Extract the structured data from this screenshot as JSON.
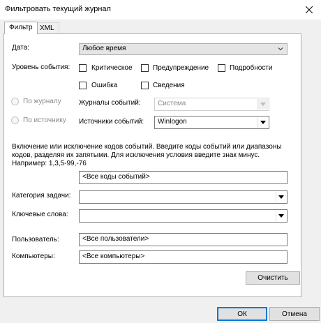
{
  "window": {
    "title": "Фильтровать текущий журнал"
  },
  "tabs": [
    {
      "label": "Фильтр"
    },
    {
      "label": "XML"
    }
  ],
  "filter": {
    "date_label": "Дата:",
    "date_value": "Любое время",
    "level_label": "Уровень события:",
    "levels": {
      "critical": "Критическое",
      "warning": "Предупреждение",
      "verbose": "Подробности",
      "error": "Ошибка",
      "info": "Сведения"
    },
    "by_log_label": "По журналу",
    "by_source_label": "По источнику",
    "event_logs_label": "Журналы событий:",
    "event_logs_value": "Система",
    "event_sources_label": "Источники событий:",
    "event_sources_value": "Winlogon",
    "description": "Включение или исключение кодов событий. Введите коды событий или диапазоны кодов, разделяя их запятыми. Для исключения условия введите знак минус. Например: 1,3,5-99,-76",
    "event_ids_value": "<Все коды событий>",
    "task_category_label": "Категория задачи:",
    "task_category_value": "",
    "keywords_label": "Ключевые слова:",
    "keywords_value": "",
    "user_label": "Пользователь:",
    "user_value": "<Все пользователи>",
    "computer_label": "Компьютеры:",
    "computer_value": "<Все компьютеры>",
    "clear_label": "Очистить"
  },
  "footer": {
    "ok_label": "ОК",
    "cancel_label": "Отмена"
  },
  "colors": {
    "accent": "#0078d7",
    "panel": "#ffffff",
    "window": "#f0f0f0"
  }
}
